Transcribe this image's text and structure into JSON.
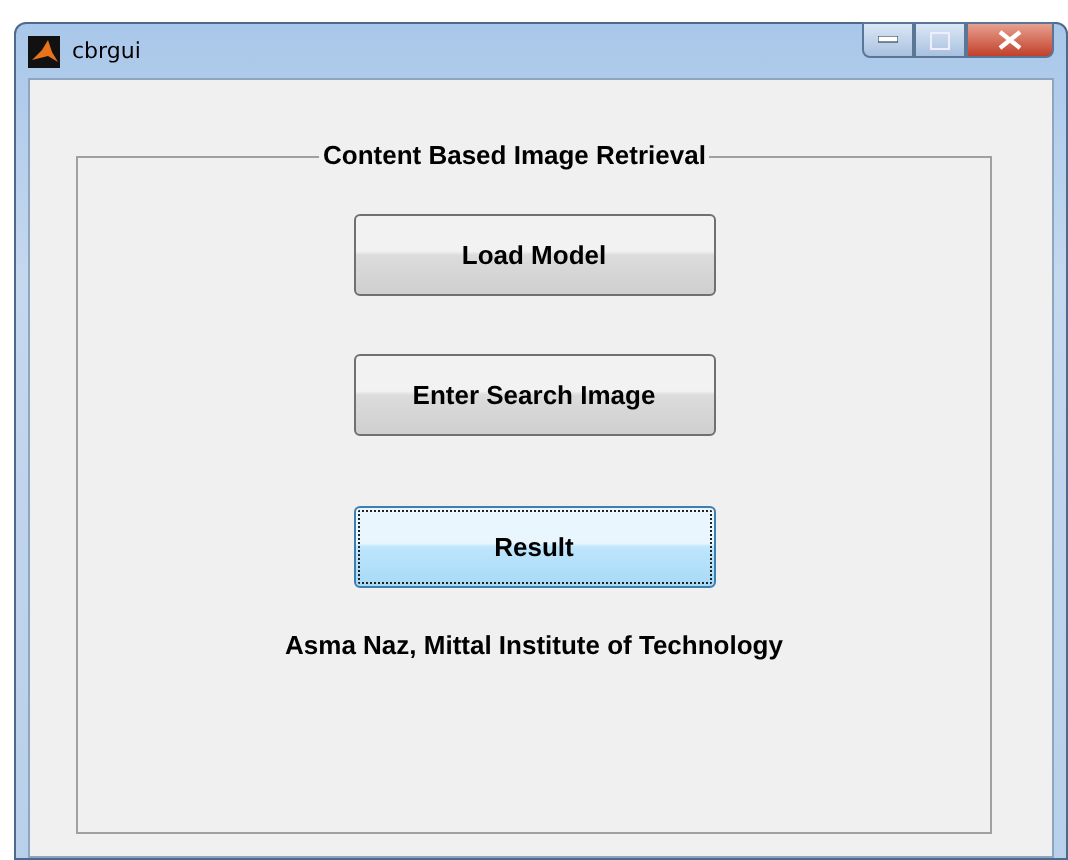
{
  "window": {
    "title": "cbrgui"
  },
  "panel": {
    "title": "Content Based Image Retrieval",
    "buttons": [
      {
        "label": "Load Model",
        "focused": false
      },
      {
        "label": "Enter Search Image",
        "focused": false
      },
      {
        "label": "Result",
        "focused": true
      }
    ],
    "credit": "Asma Naz, Mittal Institute of Technology"
  }
}
